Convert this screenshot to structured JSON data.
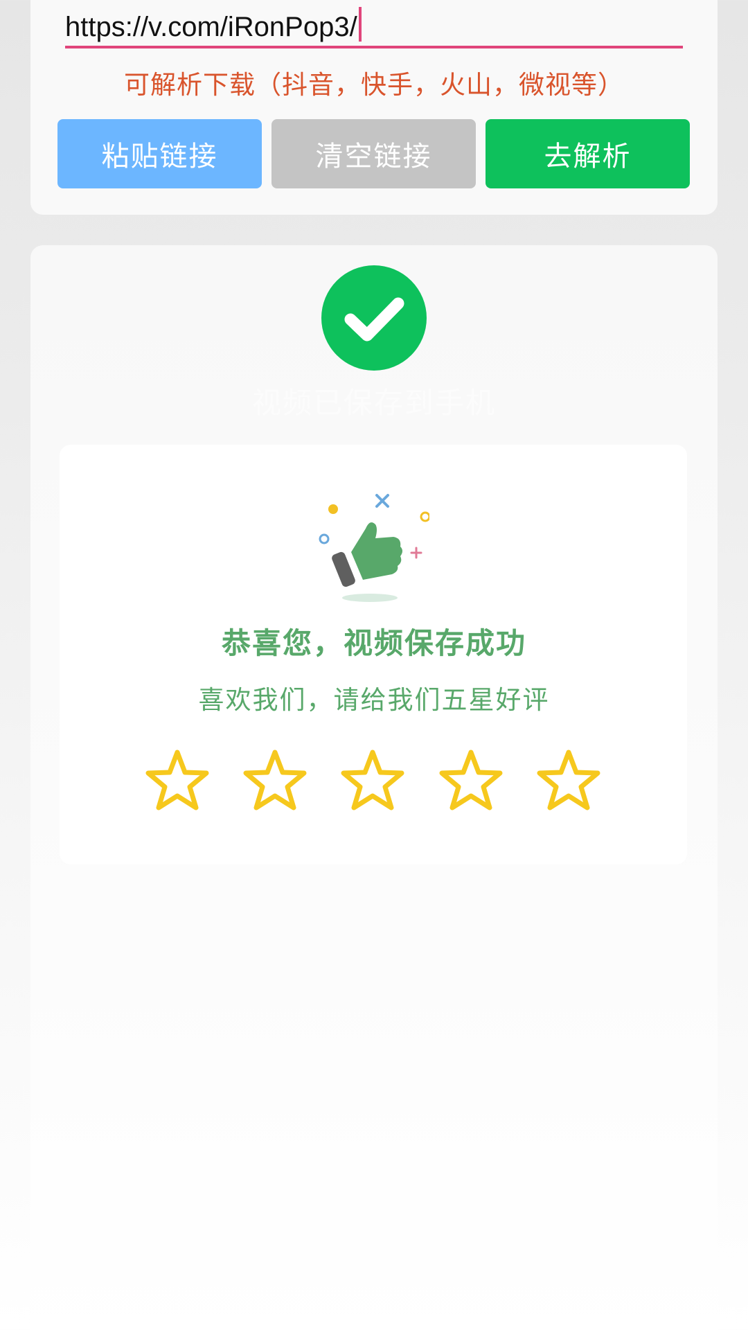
{
  "input": {
    "url_value": "https://v.com/iRonPop3/",
    "hint": "可解析下载（抖音，快手，火山，微视等）"
  },
  "buttons": {
    "paste_label": "粘贴链接",
    "clear_label": "清空链接",
    "parse_label": "去解析"
  },
  "result": {
    "faded_caption": "视频已保存到手机",
    "rating_title": "恭喜您，视频保存成功",
    "rating_subtitle": "喜欢我们，请给我们五星好评",
    "stars_total": 5,
    "stars_filled": 0
  },
  "colors": {
    "accent_pink": "#e0457b",
    "hint_red": "#d9542c",
    "paste_blue": "#6cb6ff",
    "clear_gray": "#c4c4c4",
    "success_green": "#0ec15c",
    "rating_green": "#58a86a",
    "star_yellow": "#f6c81d"
  },
  "icons": {
    "success": "check-circle-icon",
    "thumb": "thumbs-up-icon",
    "star": "star-outline-icon"
  }
}
